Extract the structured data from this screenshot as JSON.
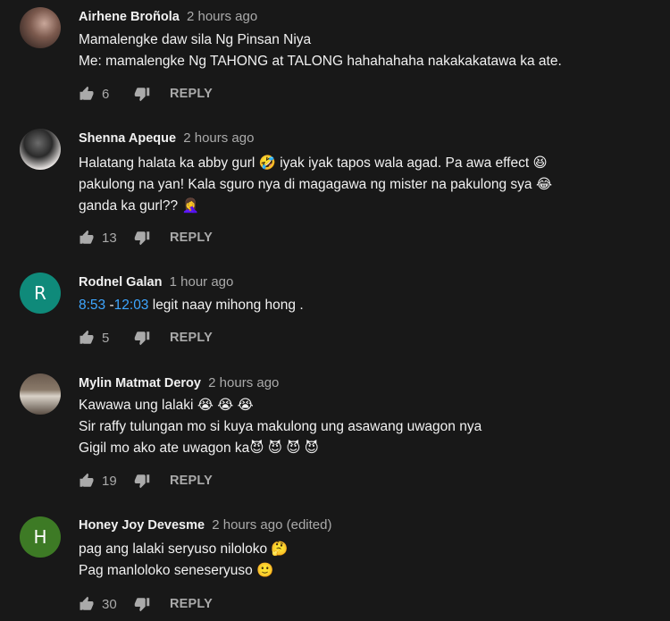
{
  "comments": [
    {
      "author": "Airhene Broñola",
      "time": "2 hours ago",
      "avatar": "photo",
      "lines": [
        "Mamalengke daw sila Ng Pinsan Niya",
        "Me: mamalengke Ng TAHONG at TALONG hahahahaha nakakakatawa ka ate."
      ],
      "likes": "6",
      "reply_label": "REPLY"
    },
    {
      "author": "Shenna Apeque",
      "time": "2 hours ago",
      "avatar": "photo",
      "lines": [
        "Halatang halata ka abby gurl 🤣 iyak iyak tapos wala agad. Pa awa effect 😆",
        "pakulong na yan! Kala sguro nya di magagawa ng mister na pakulong sya 😂",
        "ganda ka gurl?? 🤦‍♀️"
      ],
      "likes": "13",
      "reply_label": "REPLY"
    },
    {
      "author": "Rodnel Galan",
      "time": "1 hour ago",
      "avatar": "R",
      "timestamp_start": "8:53",
      "timestamp_sep": " -",
      "timestamp_end": "12:03",
      "text_after_timestamps": " legit naay mihong hong .",
      "likes": "5",
      "reply_label": "REPLY"
    },
    {
      "author": "Mylin Matmat Deroy",
      "time": "2 hours ago",
      "avatar": "photo",
      "lines": [
        "Kawawa ung lalaki 😭 😭 😭",
        "Sir raffy tulungan mo si kuya makulong ung asawang uwagon nya",
        "Gigil mo ako ate uwagon ka😈 😈 😈 😈"
      ],
      "likes": "19",
      "reply_label": "REPLY"
    },
    {
      "author": "Honey Joy Devesme",
      "time": "2 hours ago (edited)",
      "avatar": "H",
      "lines": [
        "pag ang lalaki seryuso nilolоko 🤔",
        "Pag manloloko seneseryuso 🙂"
      ],
      "likes": "30",
      "reply_label": "REPLY"
    }
  ],
  "icons": {
    "like": "thumb-up-icon",
    "dislike": "thumb-down-icon"
  },
  "colors": {
    "background": "#181818",
    "text": "#f1f1f1",
    "secondary": "#aaaaaa",
    "link": "#3ea6ff"
  }
}
